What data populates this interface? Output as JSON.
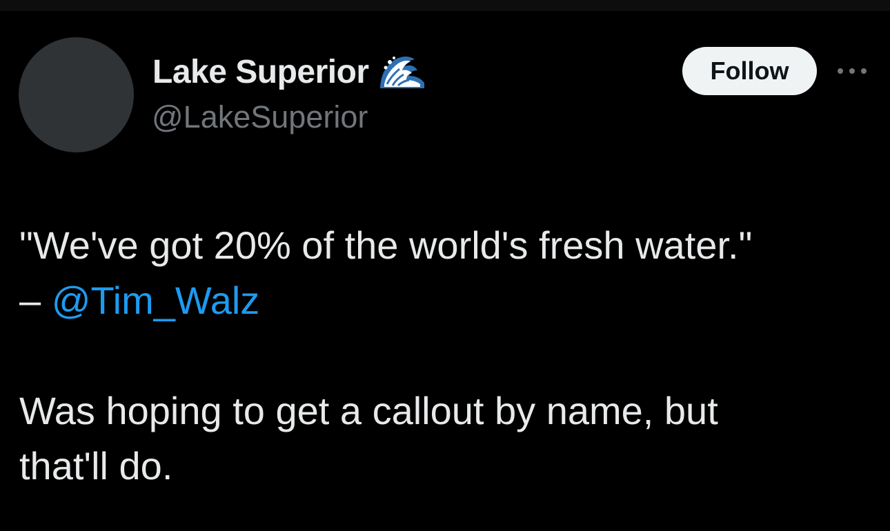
{
  "author": {
    "display_name": "Lake Superior",
    "handle": "@LakeSuperior",
    "name_emoji": "wave-emoji-icon"
  },
  "actions": {
    "follow_label": "Follow",
    "more_icon": "more-horizontal-icon"
  },
  "tweet": {
    "quote_line": "\"We've got 20% of the world's fresh water.\"",
    "attribution_prefix": "– ",
    "mention": "@Tim_Walz",
    "body_line_1": "Was hoping to get a callout by name, but",
    "body_line_2": "that'll do."
  },
  "colors": {
    "background": "#000000",
    "text_primary": "#e7e9ea",
    "text_secondary": "#71767b",
    "link": "#1d9bf0",
    "follow_bg": "#eff3f4",
    "follow_text": "#0f1419"
  }
}
